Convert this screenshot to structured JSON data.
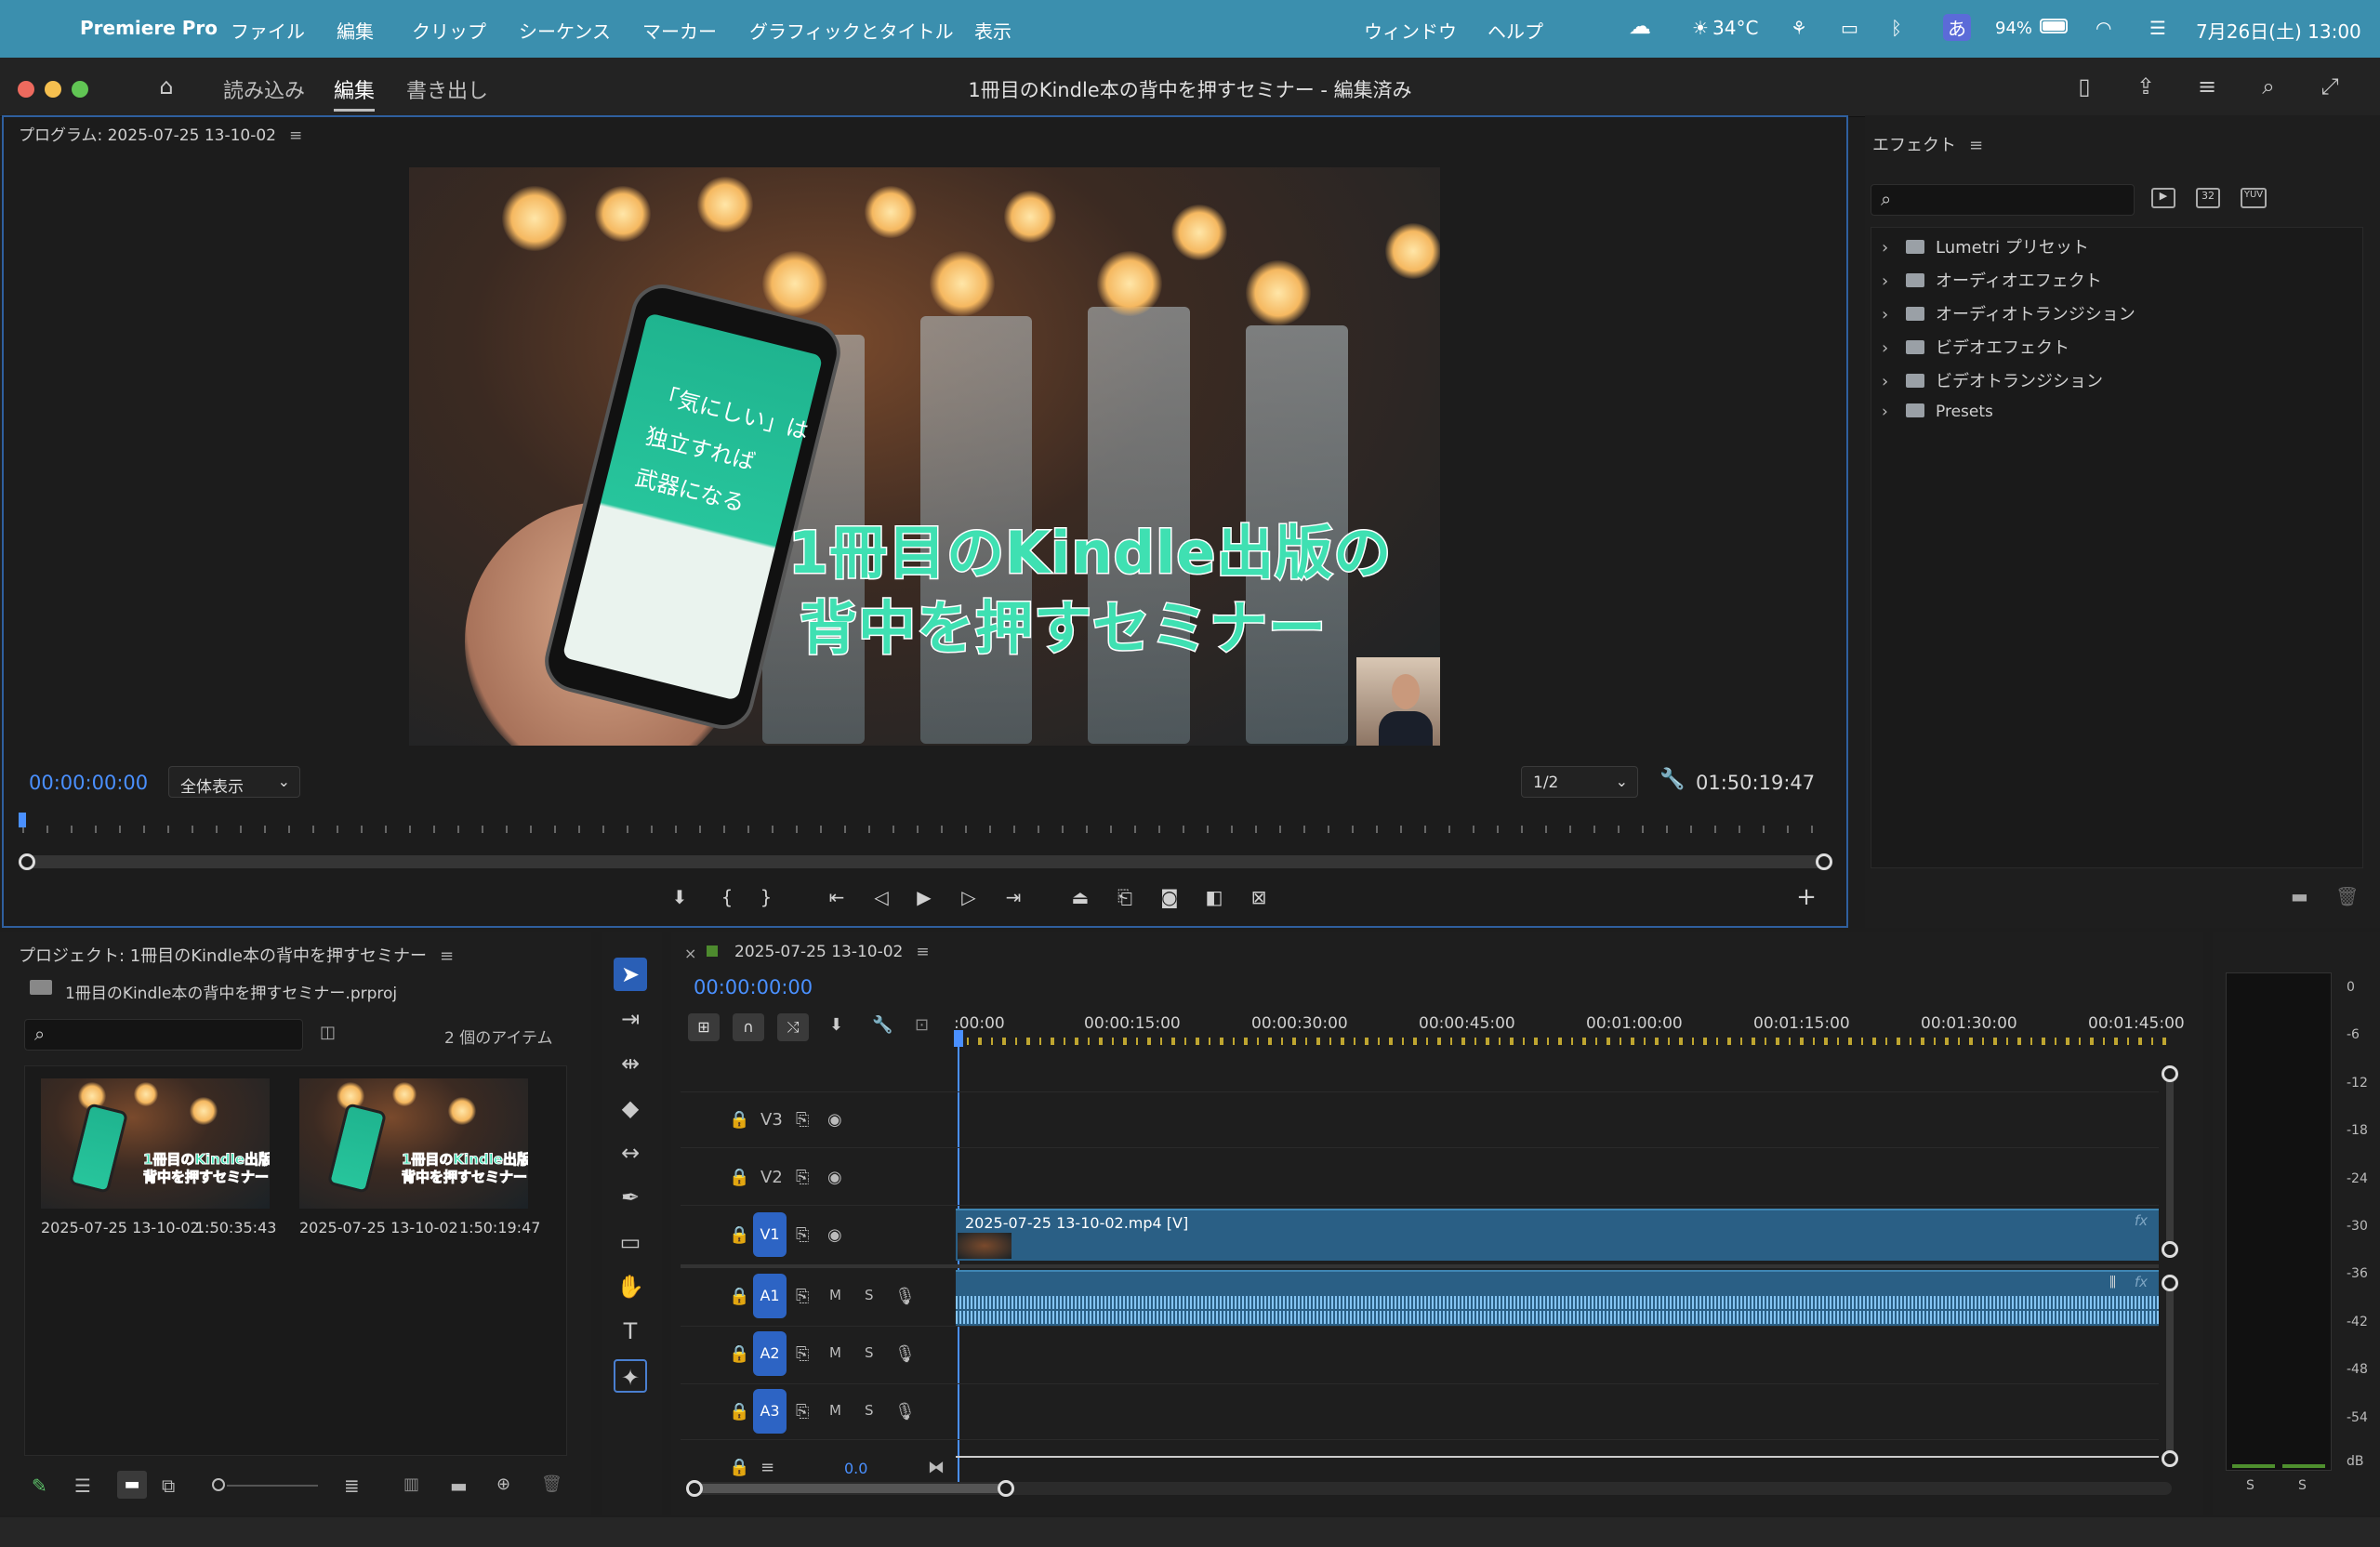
{
  "menubar": {
    "app_name": "Premiere Pro",
    "items": [
      "ファイル",
      "編集",
      "クリップ",
      "シーケンス",
      "マーカー",
      "グラフィックとタイトル",
      "表示",
      "ウィンドウ",
      "ヘルプ"
    ],
    "weather": "34°C",
    "input_mode": "あ",
    "battery": "94%",
    "datetime": "7月26日(土) 13:00"
  },
  "workspace": {
    "tabs": [
      "読み込み",
      "編集",
      "書き出し"
    ],
    "active_tab": "編集",
    "doc_title": "1冊目のKindle本の背中を押すセミナー - 編集済み"
  },
  "program": {
    "title": "プログラム: 2025-07-25 13-10-02",
    "overlay_line1": "1冊目のKindle出版の",
    "overlay_line2": "背中を押すセミナー",
    "phone_text": "「気にしい」は\n独立すれば\n武器になる",
    "timecode": "00:00:00:00",
    "fit": "全体表示",
    "resolution": "1/2",
    "duration": "01:50:19:47"
  },
  "effects": {
    "title": "エフェクト",
    "search_placeholder": "",
    "items": [
      "Lumetri プリセット",
      "オーディオエフェクト",
      "オーディオトランジション",
      "ビデオエフェクト",
      "ビデオトランジション",
      "Presets"
    ]
  },
  "project": {
    "title": "プロジェクト: 1冊目のKindle本の背中を押すセミナー",
    "file": "1冊目のKindle本の背中を押すセミナー.prproj",
    "item_count": "2 個のアイテム",
    "thumb_text_1": "1冊目のKindle出版の",
    "thumb_text_2": "背中を押すセミナー",
    "items": [
      {
        "name": "2025-07-25 13-10-02...",
        "duration": "1:50:35:43"
      },
      {
        "name": "2025-07-25 13-10-02",
        "duration": "1:50:19:47"
      }
    ]
  },
  "timeline": {
    "sequence_name": "2025-07-25 13-10-02",
    "timecode": "00:00:00:00",
    "ruler": [
      ":00:00",
      "00:00:15:00",
      "00:00:30:00",
      "00:00:45:00",
      "00:01:00:00",
      "00:01:15:00",
      "00:01:30:00",
      "00:01:45:00"
    ],
    "video_tracks": [
      "V3",
      "V2",
      "V1"
    ],
    "audio_tracks": [
      "A1",
      "A2",
      "A3"
    ],
    "video_clip": "2025-07-25 13-10-02.mp4 [V]",
    "mute": "M",
    "solo": "S",
    "master_value": "0.0"
  },
  "meters": {
    "scale": [
      "0",
      "-6",
      "-12",
      "-18",
      "-24",
      "-30",
      "-36",
      "-42",
      "-48",
      "-54",
      "dB"
    ],
    "channels": [
      "S",
      "S"
    ]
  }
}
